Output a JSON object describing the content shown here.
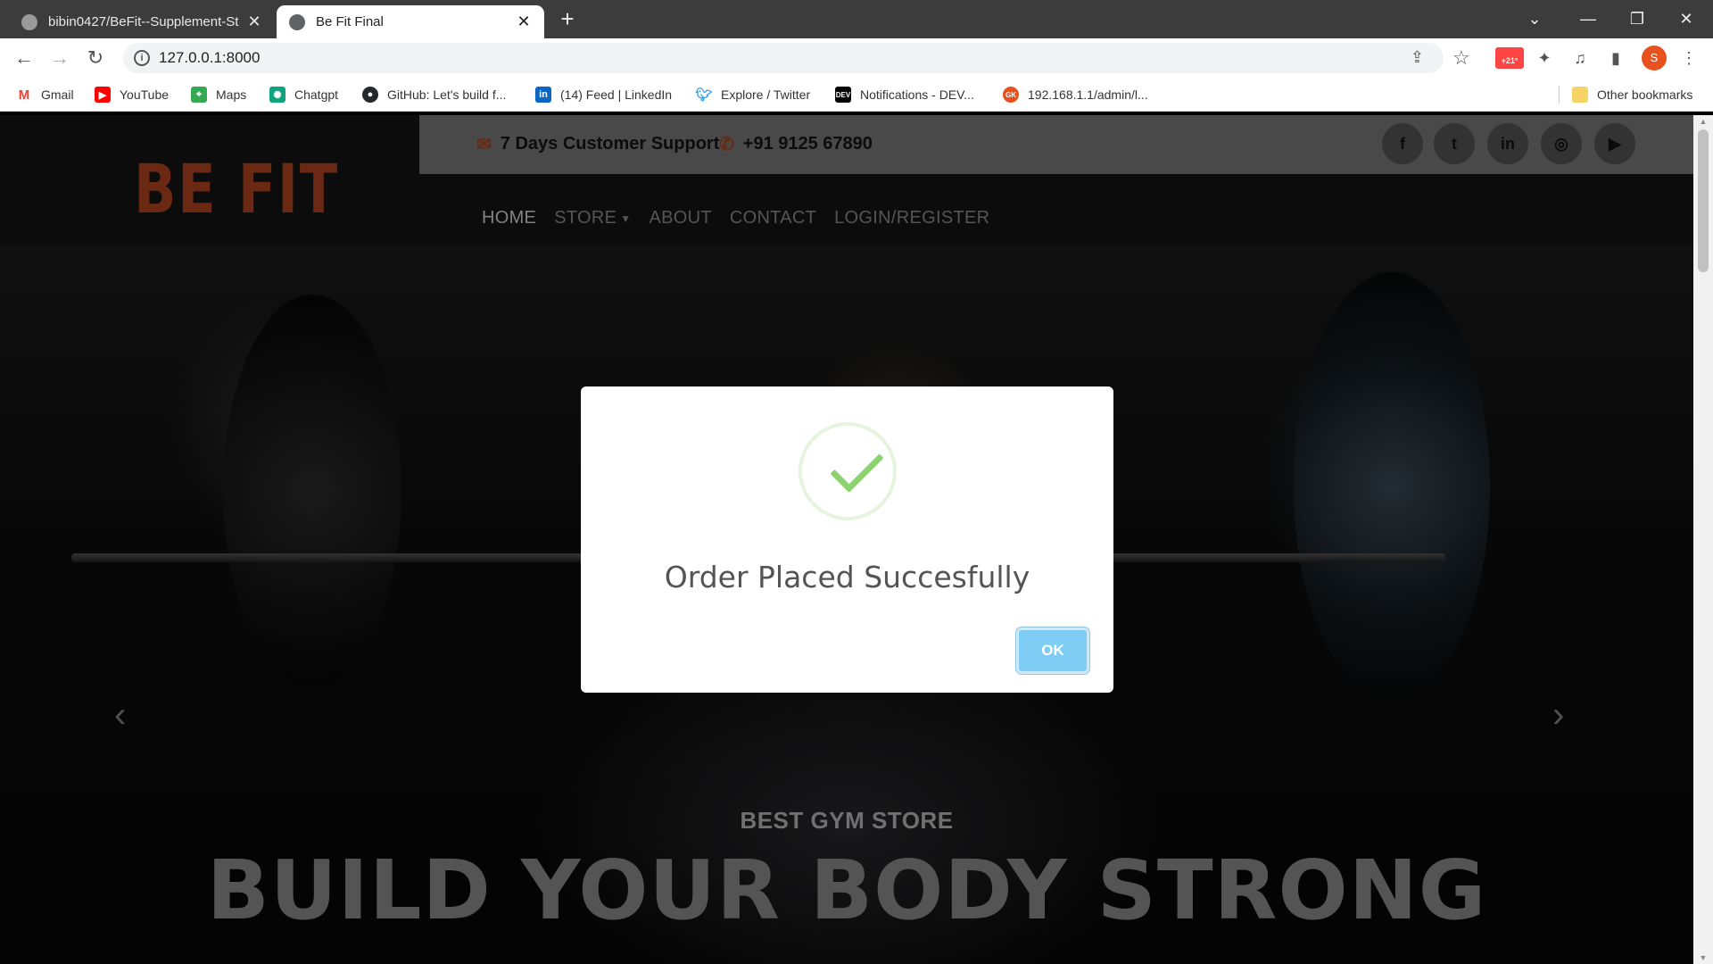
{
  "browser": {
    "tabs": [
      {
        "title": "bibin0427/BeFit--Supplement-St",
        "active": false
      },
      {
        "title": "Be Fit Final",
        "active": true
      }
    ],
    "new_tab": "+",
    "url": "127.0.0.1:8000",
    "profile_initial": "S",
    "weather_badge": "+21°",
    "bookmarks": [
      {
        "label": "Gmail",
        "icon": "gmail-icon",
        "color": "#ea4335"
      },
      {
        "label": "YouTube",
        "icon": "youtube-icon",
        "color": "#ff0000"
      },
      {
        "label": "Maps",
        "icon": "maps-icon",
        "color": "#34a853"
      },
      {
        "label": "Chatgpt",
        "icon": "chatgpt-icon",
        "color": "#10a37f"
      },
      {
        "label": "GitHub: Let's build f...",
        "icon": "github-icon",
        "color": "#24292e"
      },
      {
        "label": "(14) Feed | LinkedIn",
        "icon": "linkedin-icon",
        "color": "#0a66c2"
      },
      {
        "label": "Explore / Twitter",
        "icon": "twitter-icon",
        "color": "#1d9bf0"
      },
      {
        "label": "Notifications - DEV...",
        "icon": "dev-icon",
        "color": "#000000"
      },
      {
        "label": "192.168.1.1/admin/l...",
        "icon": "router-icon",
        "color": "#e8501e"
      }
    ],
    "other_bookmarks": "Other bookmarks"
  },
  "site": {
    "logo": "BE FIT",
    "support_text": "7 Days Customer Support",
    "phone": "+91 9125 67890",
    "social": [
      "facebook-icon",
      "twitter-icon",
      "linkedin-icon",
      "instagram-icon",
      "youtube-icon"
    ],
    "nav": [
      {
        "label": "HOME",
        "active": true
      },
      {
        "label": "STORE",
        "dropdown": true
      },
      {
        "label": "ABOUT"
      },
      {
        "label": "CONTACT"
      },
      {
        "label": "LOGIN/REGISTER"
      }
    ],
    "hero_subtitle": "BEST GYM STORE",
    "hero_title": "BUILD YOUR BODY STRONG"
  },
  "modal": {
    "title": "Order Placed Succesfully",
    "ok_label": "OK",
    "icon": "success-check-icon"
  },
  "colors": {
    "brand": "#b2441f",
    "ok_button": "#7fcdf5",
    "check": "#8cd26f"
  }
}
